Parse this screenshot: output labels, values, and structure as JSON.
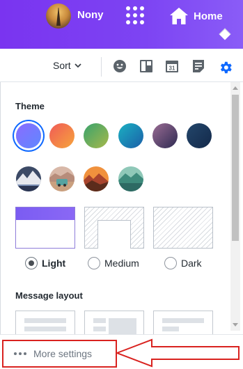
{
  "header": {
    "user_name": "Nony",
    "home_label": "Home",
    "avatar_icon": "eiffel-tower-avatar",
    "apps_icon": "grid-dots-icon",
    "home_icon": "home-icon"
  },
  "toolbar": {
    "sort_label": "Sort",
    "icons": [
      "smiley-icon",
      "layout-panel-icon",
      "calendar-icon",
      "notepad-icon",
      "gear-icon"
    ],
    "calendar_day": "31",
    "accent_color": "#0f69ff"
  },
  "theme": {
    "title": "Theme",
    "colors": [
      "#6b78ff",
      "#f26b3a",
      "#4fae5e",
      "#1e7fb9",
      "#4b3a6e",
      "#1b3a5a"
    ],
    "photo_themes": [
      "mountain-lake",
      "desert-van",
      "autumn-forest",
      "turquoise-mountains"
    ],
    "selected_index": 0
  },
  "modes": {
    "options": [
      "Light",
      "Medium",
      "Dark"
    ],
    "selected": "Light"
  },
  "message_layout": {
    "title": "Message layout"
  },
  "footer": {
    "more_settings_label": "More settings",
    "highlight_color": "#d9221f"
  }
}
